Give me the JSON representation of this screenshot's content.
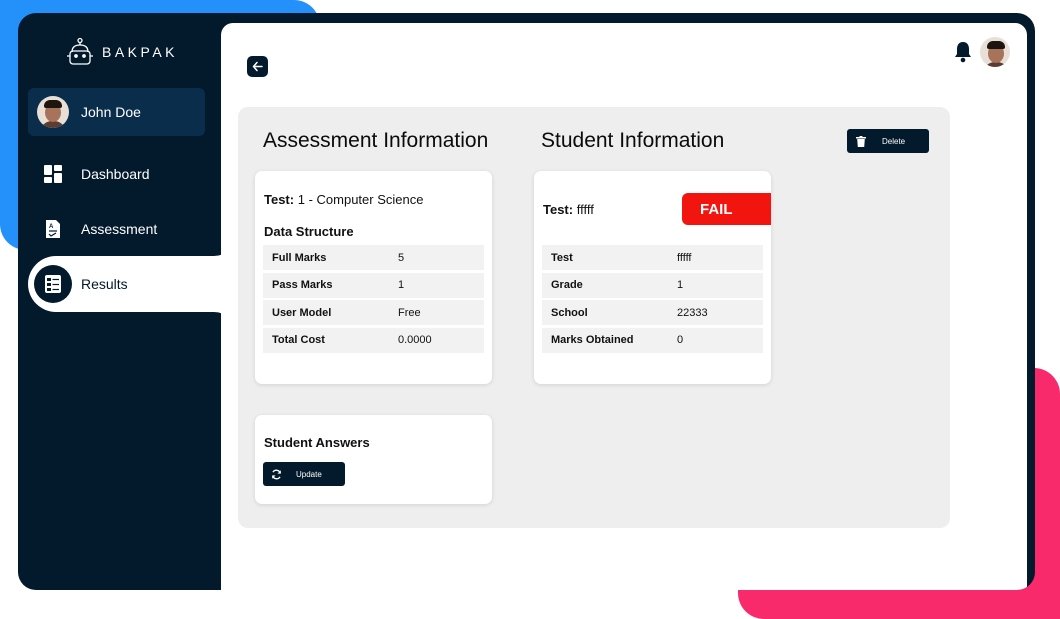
{
  "brand": {
    "name": "BAKPAK",
    "icon": "robot-backpack-icon"
  },
  "user": {
    "name": "John Doe"
  },
  "nav": {
    "dashboard": "Dashboard",
    "assessment": "Assessment",
    "results": "Results"
  },
  "colors": {
    "sidebar": "#03192c",
    "accent_blue": "#2491fa",
    "accent_pink": "#f92a6c",
    "fail": "#f2140f",
    "panel": "#eeeeee"
  },
  "headings": {
    "assessment": "Assessment Information",
    "student": "Student Information"
  },
  "buttons": {
    "delete": "Delete",
    "update": "Update"
  },
  "assessment": {
    "test_label": "Test:",
    "test_value": "1 - Computer Science",
    "subject": "Data Structure",
    "rows": [
      {
        "key": "Full Marks",
        "value": "5"
      },
      {
        "key": "Pass Marks",
        "value": "1"
      },
      {
        "key": "User Model",
        "value": "Free"
      },
      {
        "key": "Total Cost",
        "value": "0.0000"
      }
    ]
  },
  "student": {
    "test_label": "Test:",
    "test_value": "fffff",
    "status": "FAIL",
    "rows": [
      {
        "key": "Test",
        "value": "fffff"
      },
      {
        "key": "Grade",
        "value": "1"
      },
      {
        "key": "School",
        "value": "22333"
      },
      {
        "key": "Marks Obtained",
        "value": "0"
      }
    ]
  },
  "answers": {
    "title": "Student Answers"
  }
}
